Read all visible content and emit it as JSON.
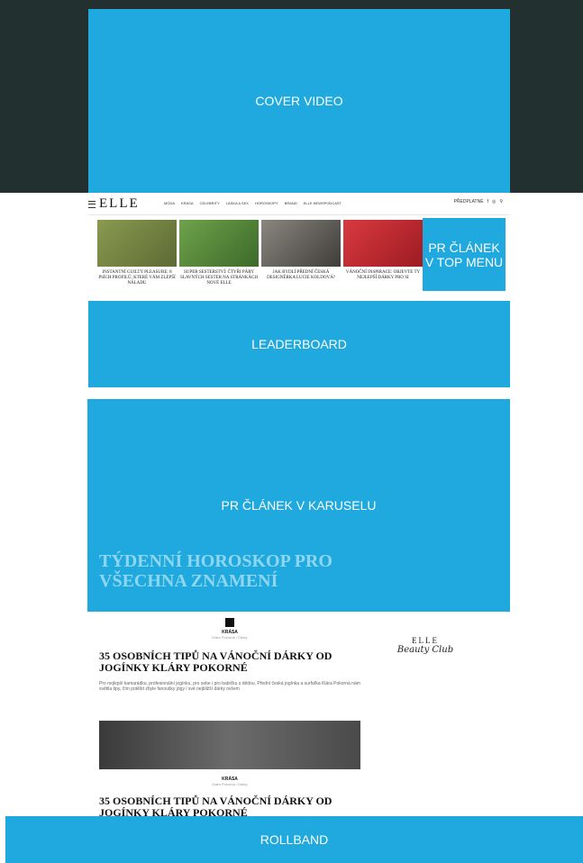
{
  "ads": {
    "cover": "COVER VIDEO",
    "pr_top": "PR ČLÁNEK V TOP MENU",
    "leaderboard": "LEADERBOARD",
    "carousel": "PR ČLÁNEK V KARUSELU",
    "rollband": "ROLLBAND"
  },
  "header": {
    "logo": "ELLE",
    "menu": [
      "MÓDA",
      "KRÁSA",
      "CELEBRITY",
      "LÁSKA A SEX",
      "HOROSKOPY",
      "BRAND",
      "ELLE NEWSPODCAST"
    ],
    "right_label": "PŘEDPLATNÉ"
  },
  "top_articles": [
    {
      "title": "INSTANTNÍ GUILTY PLEASURE: 8 PSÍCH PROFILŮ, KTERÉ VÁM ZLEPŠÍ NÁLADU",
      "image_color": "#6d7a3e"
    },
    {
      "title": "SUPER SESTERSTVÍ: ČTYŘI PÁRY SLAVNÝCH SESTER NA STRÁNKÁCH NOVÉ ELLE",
      "image_color": "#5a8a3b"
    },
    {
      "title": "JAK BYDLÍ PŘEDNÍ ČESKÁ DESIGNÉRKA LUCIE KOLDOVÁ?",
      "image_color": "#5c5a55"
    },
    {
      "title": "VÁNOČNÍ INSPIRACE: OBJEVTE TY NEJLEPŠÍ DÁRKY PRO SI",
      "image_color": "#c8262f"
    }
  ],
  "carousel_title": "TÝDENNÍ HOROSKOP PRO VŠECHNA ZNAMENÍ",
  "articles": [
    {
      "category": "KRÁSA",
      "subline": "Klára Pokorná / Dárky",
      "title": "35 OSOBNÍCH TIPŮ NA VÁNOČNÍ DÁRKY OD JOGÍNKY KLÁRY POKORNÉ",
      "desc": "Pro nejlepší kamarádku, profesionální jogínku, pro sebe i pro babičku s dědou. Přední česká jogínka a surfařka Klára Pokorná nám světila tipy, čím potěšit zbyle fanoušky jógy i své nejbližší dárky ovšem"
    },
    {
      "category": "KRÁSA",
      "subline": "Klára Pokorná / Dárky",
      "title": "35 OSOBNÍCH TIPŮ NA VÁNOČNÍ DÁRKY OD JOGÍNKY KLÁRY POKORNÉ",
      "desc": ""
    }
  ],
  "sidebar_logo": {
    "brand": "ELLE",
    "script": "Beauty Club"
  },
  "colors": {
    "ad_blue": "#1fa9df",
    "dark_bg": "#22302f"
  }
}
